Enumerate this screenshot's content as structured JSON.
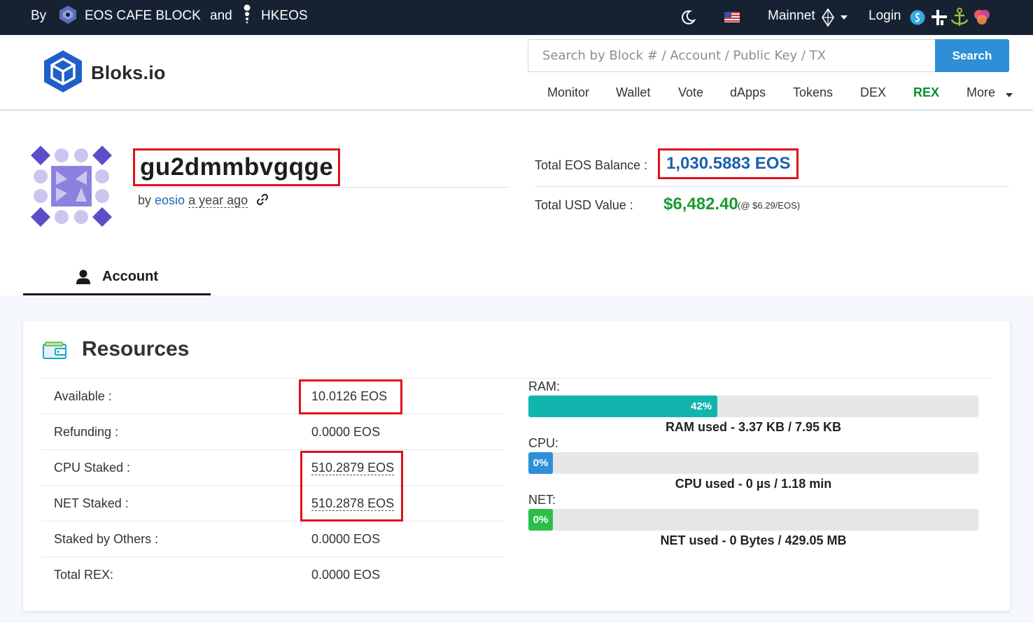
{
  "topbar": {
    "by_label": "By",
    "partner1": "EOS CAFE BLOCK",
    "and_label": "and",
    "partner2": "HKEOS",
    "network": "Mainnet",
    "login_label": "Login"
  },
  "header": {
    "logo_text": "Bloks.io",
    "search_placeholder": "Search by Block # / Account / Public Key / TX",
    "search_button": "Search",
    "nav": [
      "Monitor",
      "Wallet",
      "Vote",
      "dApps",
      "Tokens",
      "DEX",
      "REX",
      "More"
    ]
  },
  "account": {
    "name": "gu2dmmbvgqge",
    "by_label": "by",
    "creator": "eosio",
    "created_ago": "a year ago",
    "balance_label": "Total EOS Balance :",
    "balance_value": "1,030.5883 EOS",
    "usd_label": "Total USD Value :",
    "usd_value": "$6,482.40",
    "usd_rate": "(@ $6.29/EOS)",
    "tab_label": "Account"
  },
  "resources": {
    "title": "Resources",
    "rows": [
      {
        "label": "Available :",
        "value": "10.0126 EOS"
      },
      {
        "label": "Refunding :",
        "value": "0.0000 EOS"
      },
      {
        "label": "CPU Staked :",
        "value": "510.2879 EOS"
      },
      {
        "label": "NET Staked :",
        "value": "510.2878 EOS"
      },
      {
        "label": "Staked by Others :",
        "value": "0.0000 EOS"
      },
      {
        "label": "Total REX:",
        "value": "0.0000 EOS"
      }
    ],
    "ram": {
      "label": "RAM:",
      "percent_text": "42%",
      "percent": 0.42,
      "caption": "RAM used - 3.37 KB / 7.95 KB"
    },
    "cpu": {
      "label": "CPU:",
      "percent_text": "0%",
      "percent": 0,
      "caption": "CPU used - 0 µs / 1.18 min"
    },
    "net": {
      "label": "NET:",
      "percent_text": "0%",
      "percent": 0,
      "caption": "NET used - 0 Bytes / 429.05 MB"
    }
  },
  "colors": {
    "topbar_bg": "#162232",
    "accent_blue": "#2d8fd6",
    "rex_green": "#0b8e33",
    "usd_green": "#1b9a30",
    "balance_blue": "#1f5fae",
    "highlight_red": "#e0101d",
    "ram_teal": "#12b5ae",
    "net_green": "#2bbf4a"
  },
  "icons": [
    "eos-cafe-logo-icon",
    "hkeos-logo-icon",
    "moon-icon",
    "us-flag-icon",
    "eos-logo-icon",
    "chevron-down-icon",
    "scatter-wallet-icon",
    "ledger-wallet-icon",
    "anchor-wallet-icon",
    "wombat-wallet-icon",
    "bloks-cube-logo-icon",
    "user-icon",
    "link-icon",
    "wallet-card-icon",
    "account-identicon"
  ]
}
